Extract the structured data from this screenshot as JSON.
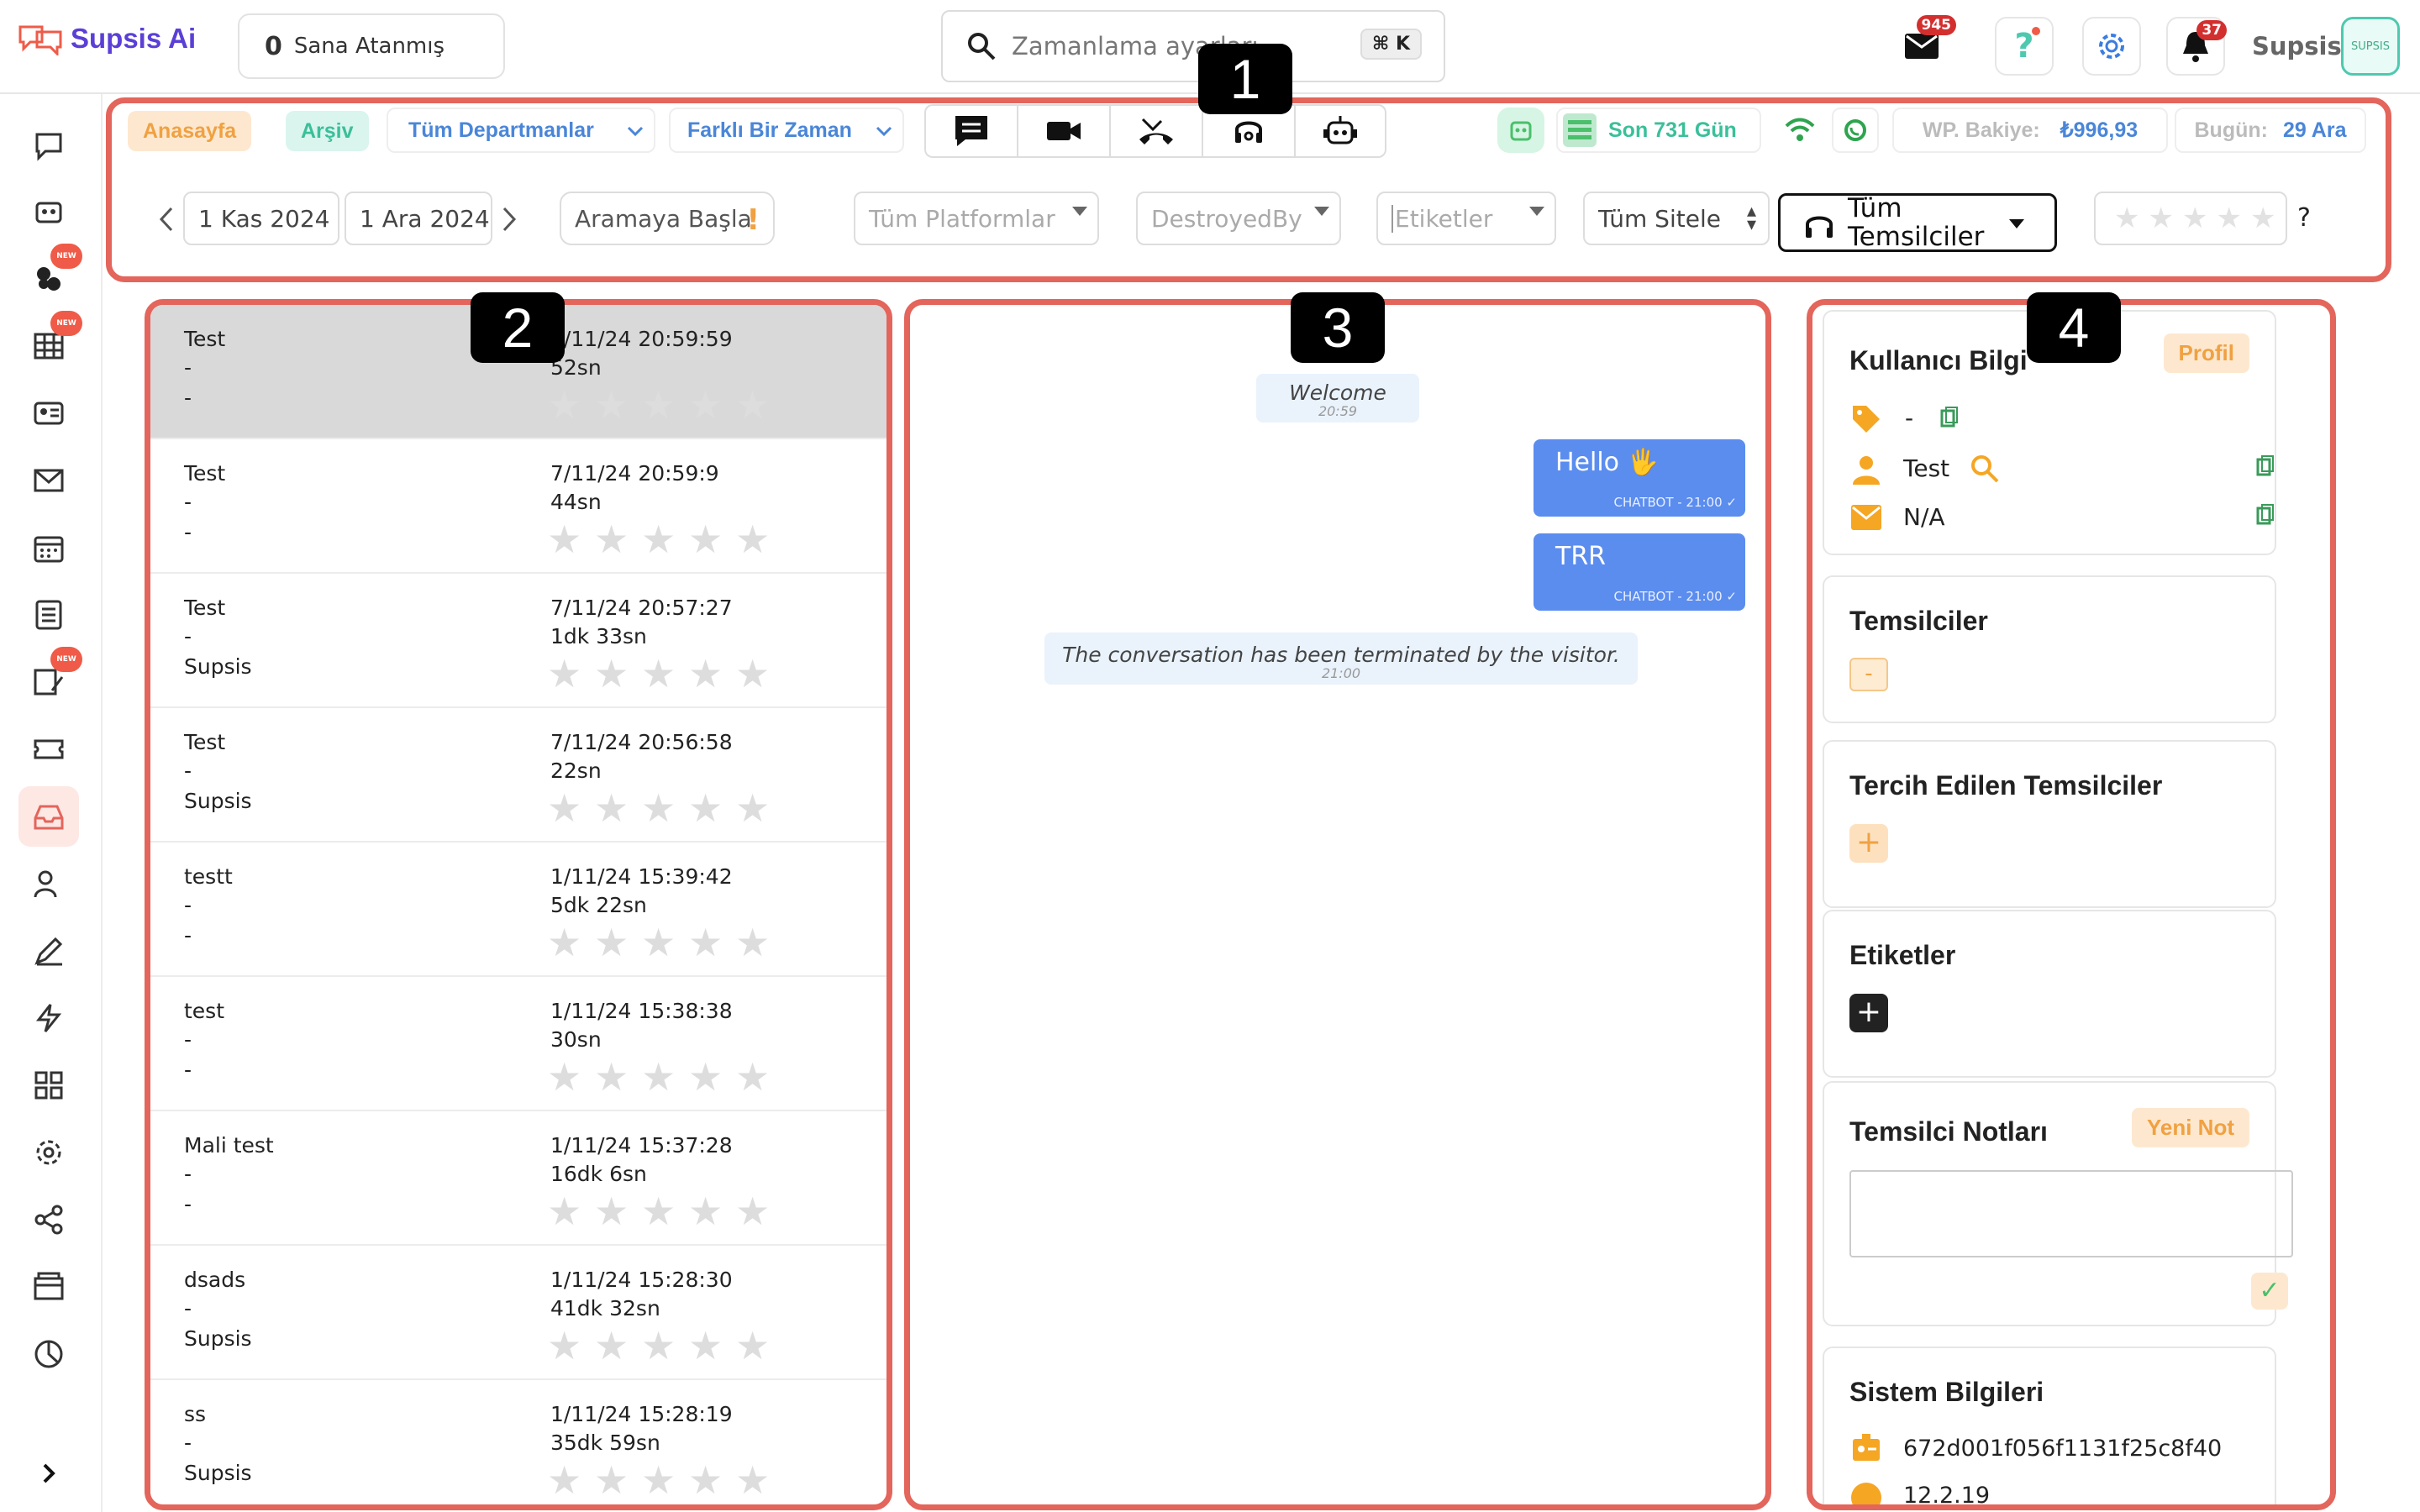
{
  "app": {
    "name": "Supsis Ai",
    "brand_color": "#5b3fd6",
    "accent": "#e3655b"
  },
  "topbar": {
    "assign": {
      "count": "0",
      "label": "Sana Atanmış"
    },
    "search": {
      "placeholder": "Zamanlama ayarları",
      "shortcut": "⌘ K"
    },
    "mail_badge": "945",
    "notif_badge": "37",
    "user": "Supsis",
    "avatar_text": "SUPSIS"
  },
  "filters": {
    "home": "Anasayfa",
    "archive": "Arşiv",
    "departments": "Tüm Departmanlar",
    "time": "Farklı Bir Zaman",
    "last_days": "Son 731 Gün",
    "balance_label": "WP. Bakiye:",
    "balance_value": "₺996,93",
    "today_label": "Bugün:",
    "today_value": "29 Ara",
    "date_from": "1 Kas 2024",
    "date_to": "1 Ara 2024",
    "search_placeholder": "Aramaya Başla",
    "platforms": "Tüm Platformlar",
    "destroyed_by": "DestroyedBy",
    "tags": "Etiketler",
    "sites": "Tüm Sitele",
    "agents": "Tüm Temsilciler",
    "question": "?"
  },
  "conversations": [
    {
      "name": "Test",
      "line2": "-",
      "line3": "-",
      "date": "7/11/24 20:59:59",
      "duration": "52sn",
      "rating": 0,
      "selected": true
    },
    {
      "name": "Test",
      "line2": "-",
      "line3": "-",
      "date": "7/11/24 20:59:9",
      "duration": "44sn",
      "rating": 0
    },
    {
      "name": "Test",
      "line2": "-",
      "line3": "Supsis",
      "date": "7/11/24 20:57:27",
      "duration": "1dk 33sn",
      "rating": 0
    },
    {
      "name": "Test",
      "line2": "-",
      "line3": "Supsis",
      "date": "7/11/24 20:56:58",
      "duration": "22sn",
      "rating": 0
    },
    {
      "name": "testt",
      "line2": "-",
      "line3": "-",
      "date": "1/11/24 15:39:42",
      "duration": "5dk 22sn",
      "rating": 0
    },
    {
      "name": "test",
      "line2": "-",
      "line3": "-",
      "date": "1/11/24 15:38:38",
      "duration": "30sn",
      "rating": 0
    },
    {
      "name": "Mali test",
      "line2": "-",
      "line3": "-",
      "date": "1/11/24 15:37:28",
      "duration": "16dk 6sn",
      "rating": 0
    },
    {
      "name": "dsads",
      "line2": "-",
      "line3": "Supsis",
      "date": "1/11/24 15:28:30",
      "duration": "41dk 32sn",
      "rating": 0
    },
    {
      "name": "ss",
      "line2": "-",
      "line3": "Supsis",
      "date": "1/11/24 15:28:19",
      "duration": "35dk 59sn",
      "rating": 0
    }
  ],
  "chat": {
    "welcome": "Welcome",
    "welcome_time": "20:59",
    "msg1": "Hello 🖐",
    "msg1_meta": "CHATBOT - 21:00 ✓",
    "msg2": "TRR",
    "msg2_meta": "CHATBOT - 21:00 ✓",
    "ended": "The conversation has been terminated by the visitor.",
    "ended_time": "21:00"
  },
  "info": {
    "user_title": "Kullanıcı Bilgi",
    "profile": "Profil",
    "tag_value": "-",
    "name_value": "Test",
    "email_value": "N/A",
    "agents_title": "Temsilciler",
    "agents_value": "-",
    "preferred_title": "Tercih Edilen Temsilciler",
    "tags_title": "Etiketler",
    "notes_title": "Temsilci Notları",
    "new_note": "Yeni Not",
    "system_title": "Sistem Bilgileri",
    "system_id": "672d001f056f1131f25c8f40",
    "system_version": "12.2.19"
  },
  "callouts": [
    "1",
    "2",
    "3",
    "4"
  ]
}
